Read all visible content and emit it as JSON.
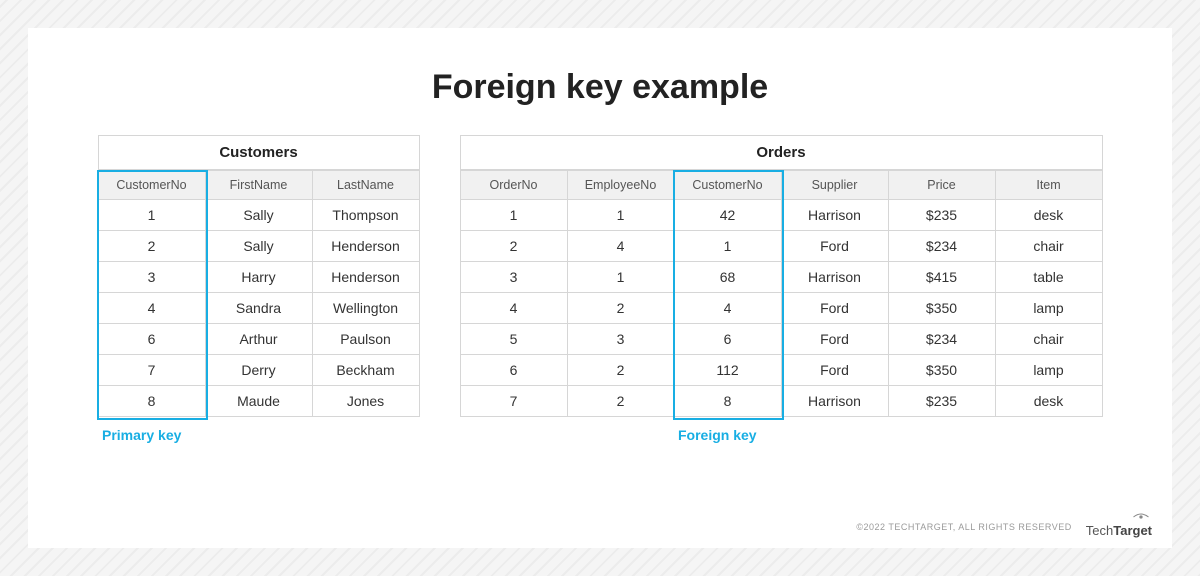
{
  "title": "Foreign key example",
  "tables": {
    "customers": {
      "caption": "Customers",
      "headers": [
        "CustomerNo",
        "FirstName",
        "LastName"
      ],
      "rows": [
        [
          "1",
          "Sally",
          "Thompson"
        ],
        [
          "2",
          "Sally",
          "Henderson"
        ],
        [
          "3",
          "Harry",
          "Henderson"
        ],
        [
          "4",
          "Sandra",
          "Wellington"
        ],
        [
          "6",
          "Arthur",
          "Paulson"
        ],
        [
          "7",
          "Derry",
          "Beckham"
        ],
        [
          "8",
          "Maude",
          "Jones"
        ]
      ],
      "key_label": "Primary key",
      "key_column_index": 0
    },
    "orders": {
      "caption": "Orders",
      "headers": [
        "OrderNo",
        "EmployeeNo",
        "CustomerNo",
        "Supplier",
        "Price",
        "Item"
      ],
      "rows": [
        [
          "1",
          "1",
          "42",
          "Harrison",
          "$235",
          "desk"
        ],
        [
          "2",
          "4",
          "1",
          "Ford",
          "$234",
          "chair"
        ],
        [
          "3",
          "1",
          "68",
          "Harrison",
          "$415",
          "table"
        ],
        [
          "4",
          "2",
          "4",
          "Ford",
          "$350",
          "lamp"
        ],
        [
          "5",
          "3",
          "6",
          "Ford",
          "$234",
          "chair"
        ],
        [
          "6",
          "2",
          "112",
          "Ford",
          "$350",
          "lamp"
        ],
        [
          "7",
          "2",
          "8",
          "Harrison",
          "$235",
          "desk"
        ]
      ],
      "key_label": "Foreign key",
      "key_column_index": 2
    }
  },
  "footer": {
    "copyright": "©2022 TECHTARGET, ALL RIGHTS RESERVED",
    "brand_light": "Tech",
    "brand_bold": "Target"
  }
}
